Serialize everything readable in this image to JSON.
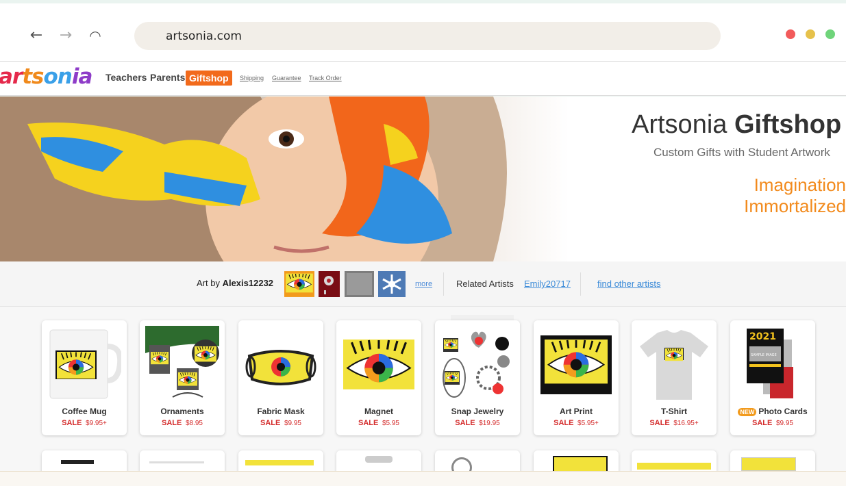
{
  "browser": {
    "url": "artsonia.com",
    "back_icon": "←",
    "forward_icon": "→",
    "reload_icon": "◠",
    "colors": {
      "close": "#f25b5b",
      "minimize": "#e6c14b",
      "maximize": "#6fd47a"
    }
  },
  "header": {
    "logo": [
      "ar",
      "ts",
      "on",
      "ia"
    ],
    "nav": {
      "teachers": "Teachers",
      "parents": "Parents",
      "giftshop": "Giftshop"
    },
    "links": {
      "shipping": "Shipping",
      "guarantee": "Guarantee",
      "track": "Track Order"
    },
    "accent": "#f26a1b"
  },
  "hero": {
    "title_plain": "Artsonia ",
    "title_bold": "Giftshop",
    "subtitle": "Custom Gifts with Student Artwork",
    "tagline_1": "Imagination",
    "tagline_2": "Immortalized"
  },
  "artbar": {
    "art_by": "Art by ",
    "artist": "Alexis12232",
    "more": "more",
    "related_label": "Related Artists",
    "related_artist": "Emily20717",
    "find_other": "find other artists"
  },
  "products": [
    {
      "name": "Coffee Mug",
      "sale": "SALE",
      "price": "$9.95+",
      "new": ""
    },
    {
      "name": "Ornaments",
      "sale": "SALE",
      "price": "$8.95",
      "new": ""
    },
    {
      "name": "Fabric Mask",
      "sale": "SALE",
      "price": "$9.95",
      "new": ""
    },
    {
      "name": "Magnet",
      "sale": "SALE",
      "price": "$5.95",
      "new": ""
    },
    {
      "name": "Snap Jewelry",
      "sale": "SALE",
      "price": "$19.95",
      "new": ""
    },
    {
      "name": "Art Print",
      "sale": "SALE",
      "price": "$5.95+",
      "new": ""
    },
    {
      "name": "T-Shirt",
      "sale": "SALE",
      "price": "$16.95+",
      "new": ""
    },
    {
      "name": "Photo Cards",
      "sale": "SALE",
      "price": "$9.95",
      "new": "NEW"
    }
  ],
  "product_images": {
    "card_year": "2021",
    "sample_label": "SAMPLE IMAGE"
  }
}
